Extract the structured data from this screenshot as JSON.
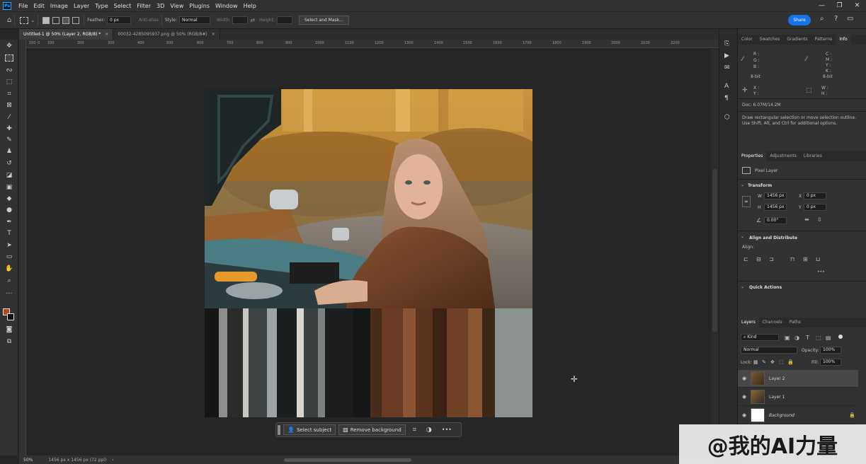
{
  "menubar": {
    "logo": "Ps",
    "items": [
      "File",
      "Edit",
      "Image",
      "Layer",
      "Type",
      "Select",
      "Filter",
      "3D",
      "View",
      "Plugins",
      "Window",
      "Help"
    ],
    "window_controls": [
      "—",
      "❐",
      "✕"
    ]
  },
  "options": {
    "feather_label": "Feather:",
    "feather_value": "0 px",
    "anti_alias": "Anti-alias",
    "style_label": "Style:",
    "style_value": "Normal",
    "width_label": "Width:",
    "height_label": "Height:",
    "select_mask": "Select and Mask...",
    "share": "Share"
  },
  "tabs": [
    {
      "label": "Untitled-1 @ 50% (Layer 2, RGB/8) *",
      "close": "×"
    },
    {
      "label": "00032-4285095937.png @ 50% (RGB/8#)",
      "close": "×"
    }
  ],
  "ruler": {
    "h": [
      "100",
      "0",
      "100",
      "200",
      "300",
      "400",
      "500",
      "600",
      "700",
      "800",
      "900",
      "1000",
      "1100",
      "1200",
      "1300",
      "1400",
      "1500",
      "1600",
      "1700",
      "1800",
      "1900",
      "2000",
      "2100",
      "2200"
    ]
  },
  "status": {
    "zoom": "50%",
    "size": "1456 px x 1456 px (72 ppi)",
    "arrow": "›"
  },
  "taskbar": {
    "select_subject": "Select subject",
    "remove_background": "Remove background",
    "more": "•••"
  },
  "info": {
    "tabs": [
      "Color",
      "Swatches",
      "Gradients",
      "Patterns",
      "Info"
    ],
    "rgb": [
      "R :",
      "G :",
      "B :"
    ],
    "cmyk": [
      "C :",
      "M :",
      "Y :",
      "K :"
    ],
    "bit1": "8-bit",
    "bit2": "8-bit",
    "xy": [
      "X :",
      "Y :"
    ],
    "wh": [
      "W :",
      "H :"
    ],
    "doc": "Doc: 6.07M/14.2M",
    "hint1": "Draw rectangular selection or move selection outline.",
    "hint2": "Use Shift, Alt, and Ctrl for additional options."
  },
  "properties": {
    "tabs": [
      "Properties",
      "Adjustments",
      "Libraries"
    ],
    "type": "Pixel Layer",
    "transform": "Transform",
    "w_label": "W",
    "w": "1456 px",
    "h_label": "H",
    "h": "1456 px",
    "x_label": "X",
    "x": "0 px",
    "y_label": "Y",
    "y": "0 px",
    "angle": "0.00°",
    "align_header": "Align and Distribute",
    "align_label": "Align:",
    "more": "•••",
    "quick_actions": "Quick Actions"
  },
  "layers": {
    "tabs": [
      "Layers",
      "Channels",
      "Paths"
    ],
    "kind": "Kind",
    "blend": "Normal",
    "opacity_label": "Opacity:",
    "opacity": "100%",
    "lock_label": "Lock:",
    "fill_label": "Fill:",
    "fill": "100%",
    "items": [
      {
        "name": "Layer 2",
        "selected": true
      },
      {
        "name": "Layer 1",
        "selected": false
      },
      {
        "name": "Background",
        "selected": false
      }
    ]
  },
  "watermark": "@我的AI力量"
}
